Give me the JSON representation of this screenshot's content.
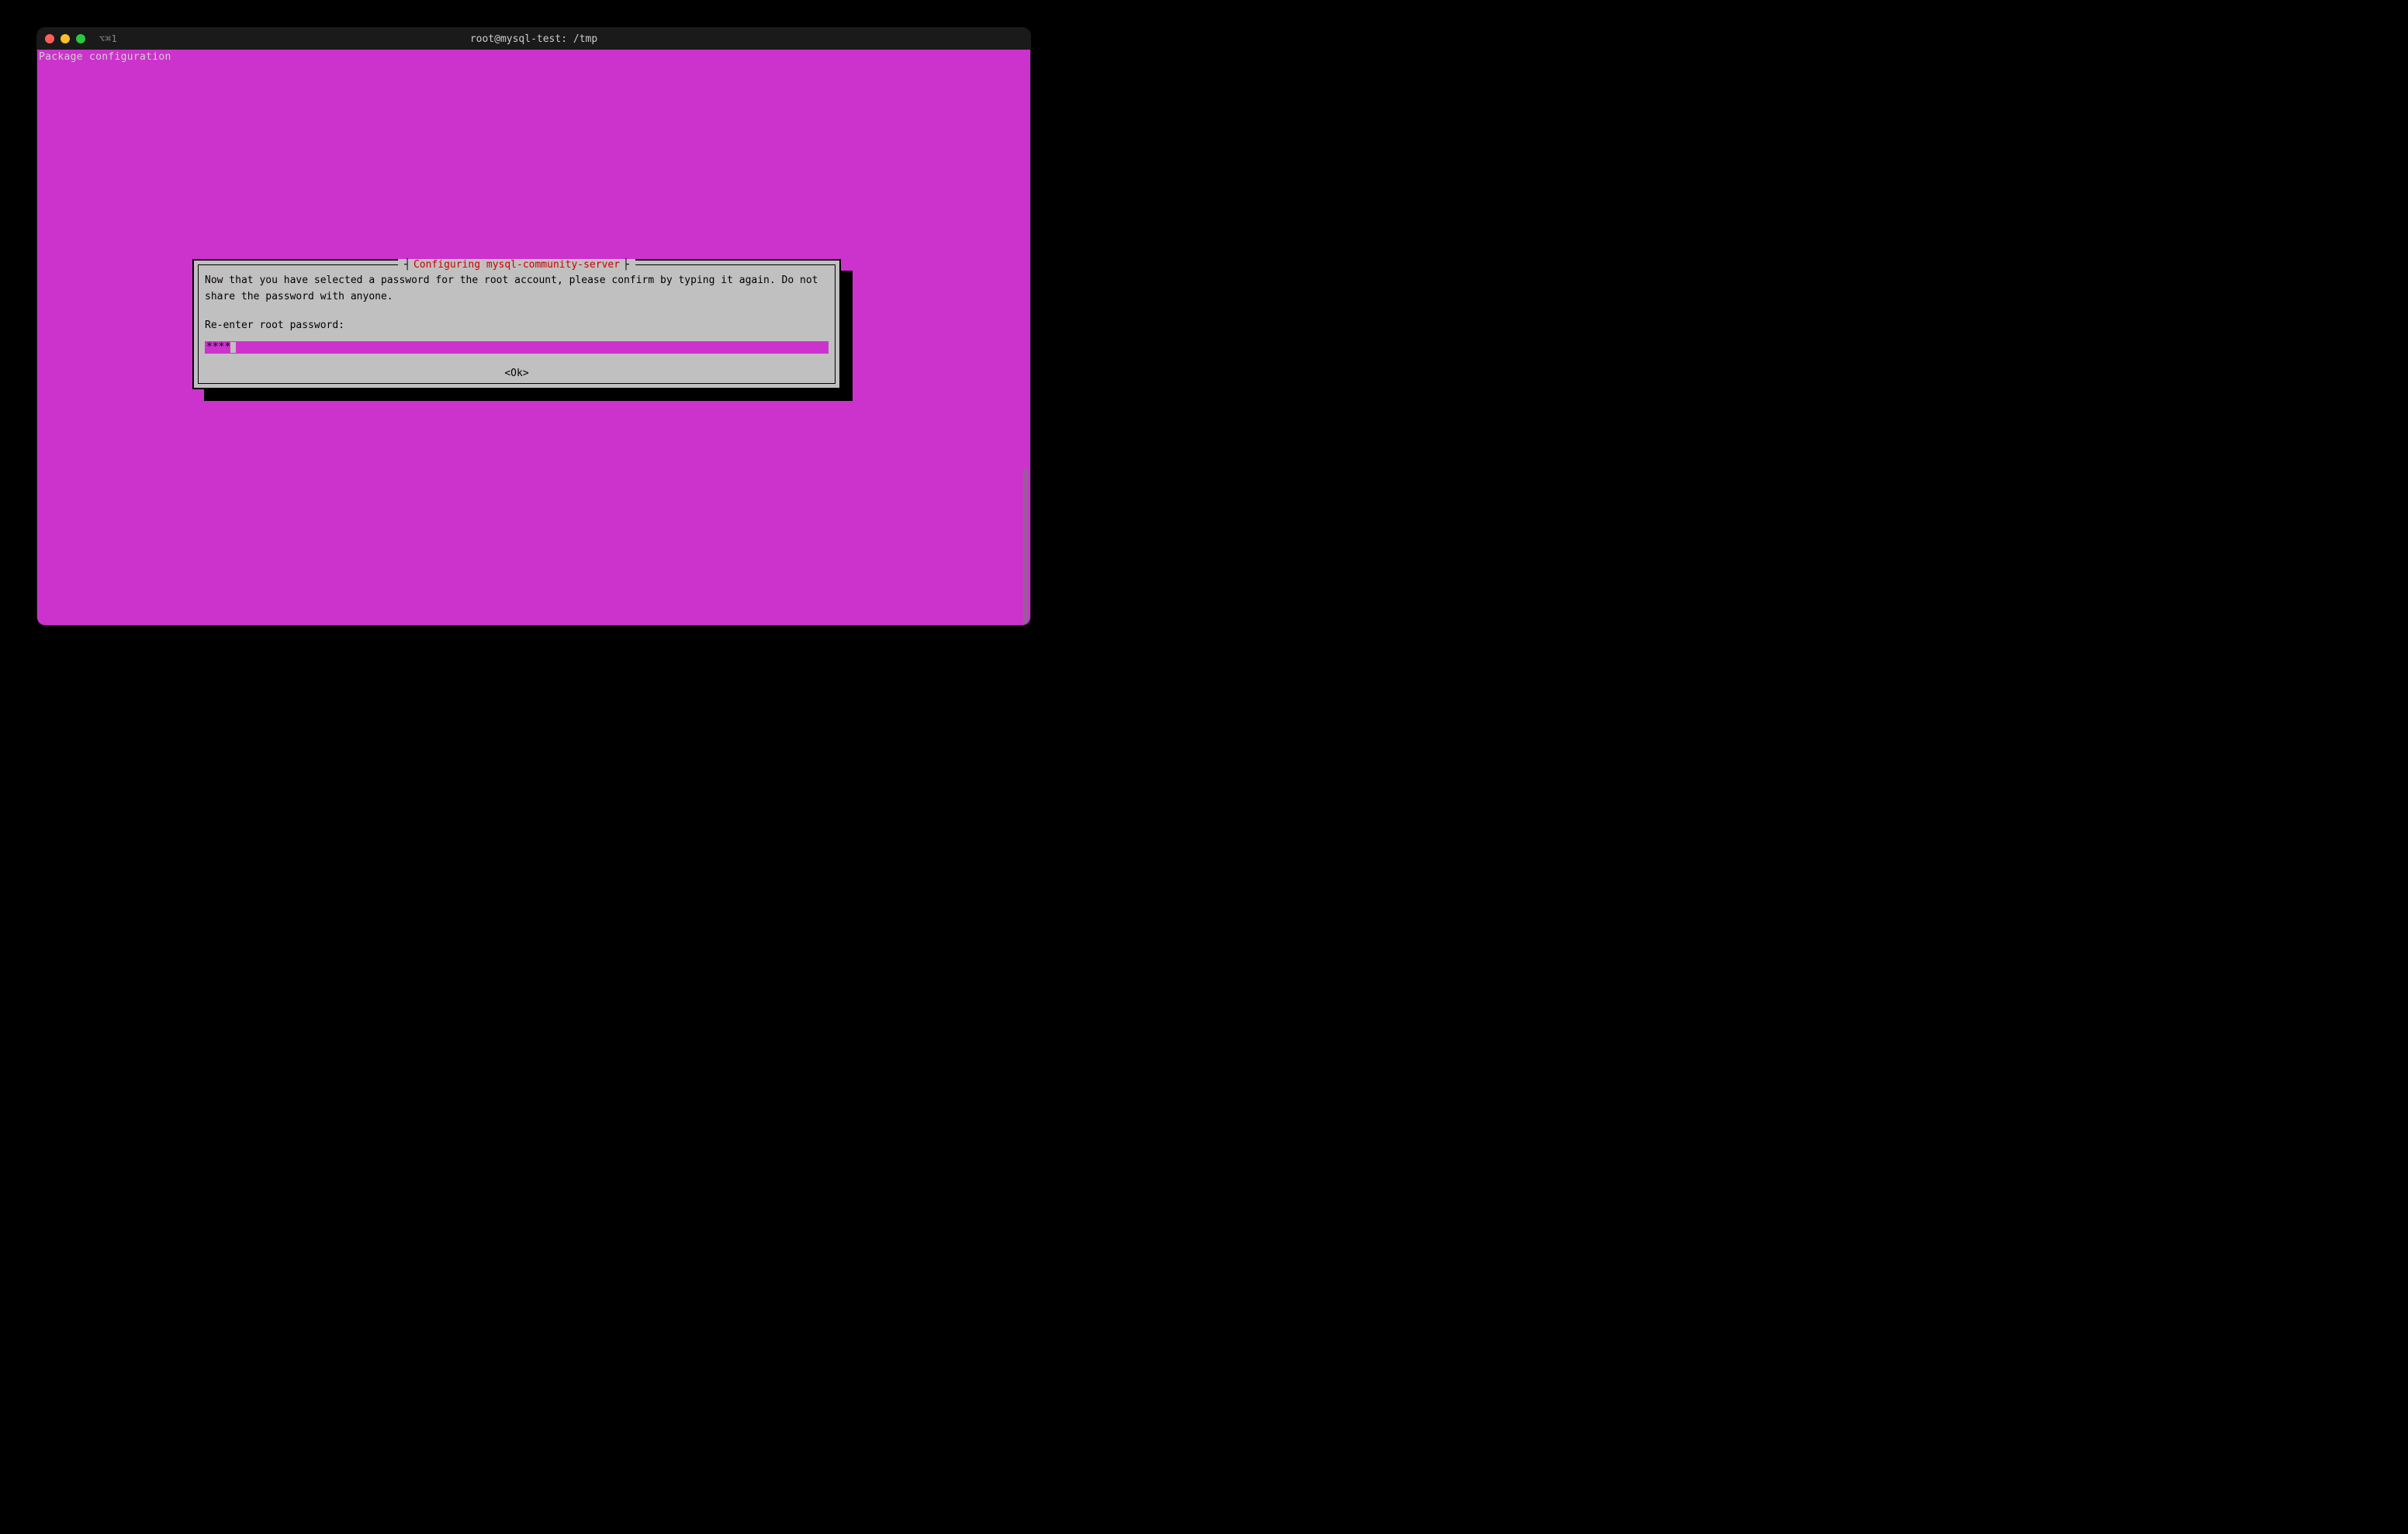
{
  "window": {
    "tab_indicator": "⌥⌘1",
    "title": "root@mysql-test: /tmp"
  },
  "terminal": {
    "header": "Package configuration"
  },
  "dialog": {
    "title": "Configuring mysql-community-server",
    "instruction": "Now that you have selected a password for the root account, please confirm by typing it again. Do not share the password with anyone.",
    "prompt": "Re-enter root password:",
    "password_value": "****",
    "ok_label": "<Ok>"
  }
}
